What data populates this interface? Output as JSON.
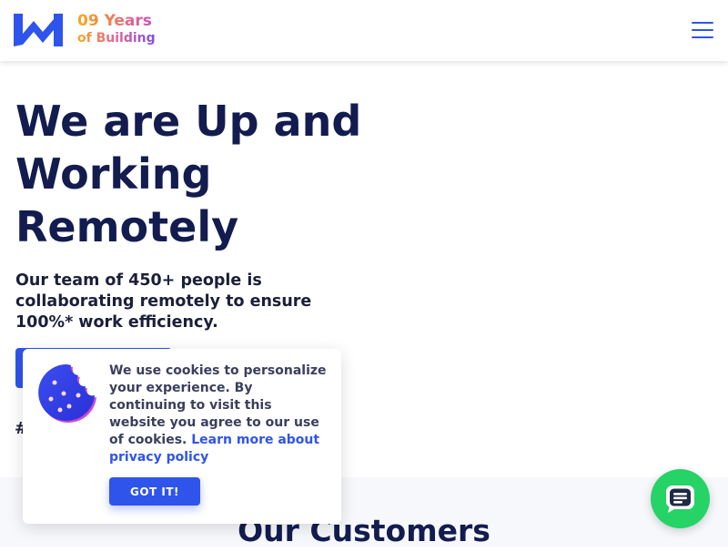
{
  "header": {
    "logo": {
      "icon": "w-logo-icon",
      "line1": "09 Years",
      "line2": "of Building"
    },
    "menu_icon": "hamburger-menu-icon"
  },
  "hero": {
    "title": "We are Up and Working Remotely",
    "subtitle": "Our team of 450+ people is collaborating remotely to ensure 100%* work efficiency.",
    "hashtag": "#"
  },
  "customers": {
    "title": "Our Customers"
  },
  "cookie_banner": {
    "icon": "cookie-icon",
    "text": "We use cookies to personalize your experience. By continuing to visit this website you agree to our use of cookies.",
    "link_text": "Learn more about privacy policy",
    "button_label": "GOT IT!"
  },
  "chat_widget": {
    "icon": "chat-bubble-icon"
  },
  "colors": {
    "brand_blue": "#2f54eb",
    "heading_navy": "#131c4f",
    "chat_green": "#25d366"
  }
}
